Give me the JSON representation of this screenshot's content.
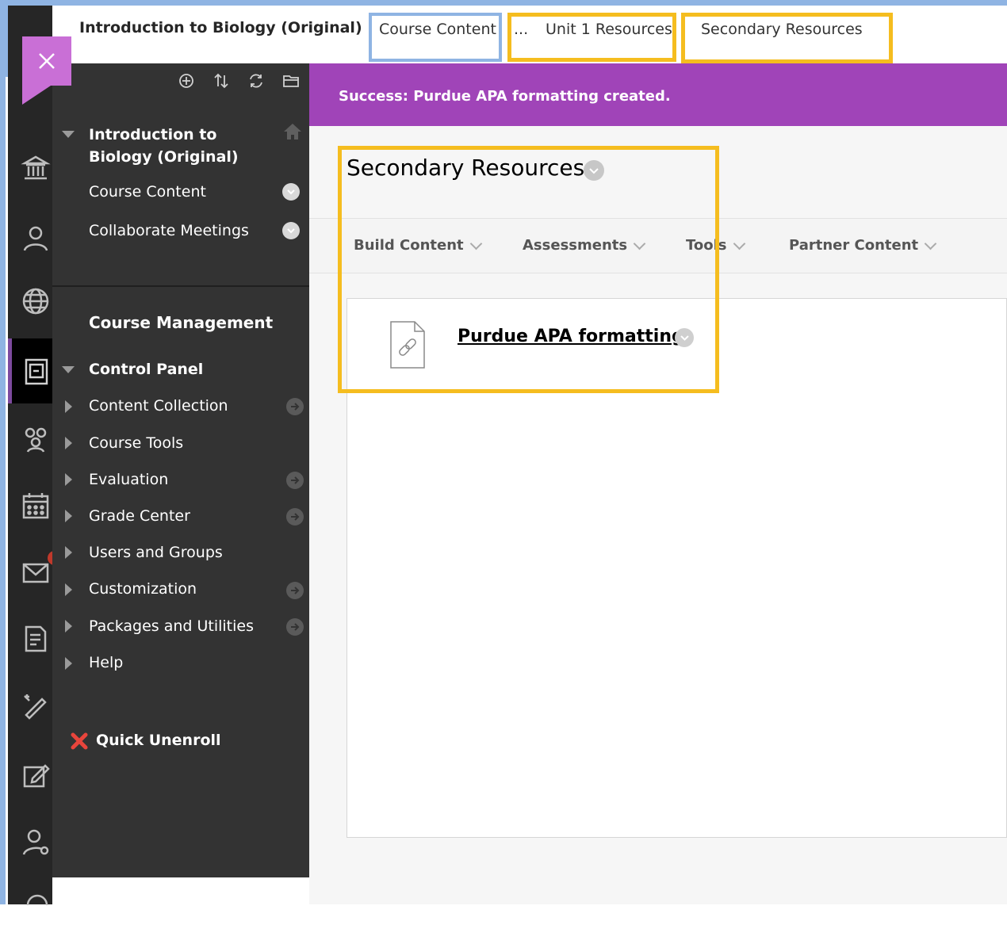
{
  "header": {
    "course_title": "Introduction to Biology (Original)",
    "breadcrumbs": [
      {
        "label": "Course Content"
      },
      {
        "label": "..."
      },
      {
        "label": "Unit 1 Resources"
      },
      {
        "label": "Secondary Resources"
      }
    ]
  },
  "colors": {
    "accent_purple": "#a044b8",
    "close_purple": "#c96fd6",
    "highlight_yellow": "#f5bd1f",
    "highlight_blue": "#8fb4e3",
    "menu_bg": "#333333",
    "iconbar_bg": "#262626"
  },
  "iconbar": {
    "icons": [
      "institution-icon",
      "profile-icon",
      "globe-icon",
      "courses-icon",
      "organizations-icon",
      "calendar-icon",
      "messages-icon",
      "grades-icon",
      "tools-icon",
      "assignment-icon",
      "admin-icon",
      "sign-out-icon"
    ],
    "active": "courses-icon"
  },
  "menu": {
    "toolbar_icons": [
      "add-menu-item-icon",
      "reorder-icon",
      "refresh-icon",
      "folder-view-icon"
    ],
    "course_title": "Introduction to Biology (Original)",
    "items": [
      {
        "label": "Course Content"
      },
      {
        "label": "Collaborate Meetings"
      }
    ],
    "management_heading": "Course Management",
    "control_panel": "Control Panel",
    "panel_items": [
      {
        "label": "Content Collection"
      },
      {
        "label": "Course Tools"
      },
      {
        "label": "Evaluation"
      },
      {
        "label": "Grade Center"
      },
      {
        "label": "Users and Groups"
      },
      {
        "label": "Customization"
      },
      {
        "label": "Packages and Utilities"
      },
      {
        "label": "Help"
      }
    ],
    "quick_unenroll": "Quick Unenroll"
  },
  "success_message": "Success: Purdue APA formatting created.",
  "page": {
    "title": "Secondary Resources",
    "action_bar": [
      {
        "label": "Build Content"
      },
      {
        "label": "Assessments"
      },
      {
        "label": "Tools"
      },
      {
        "label": "Partner Content"
      }
    ],
    "items": [
      {
        "title": "Purdue APA formatting",
        "icon": "web-link-file-icon"
      }
    ]
  }
}
